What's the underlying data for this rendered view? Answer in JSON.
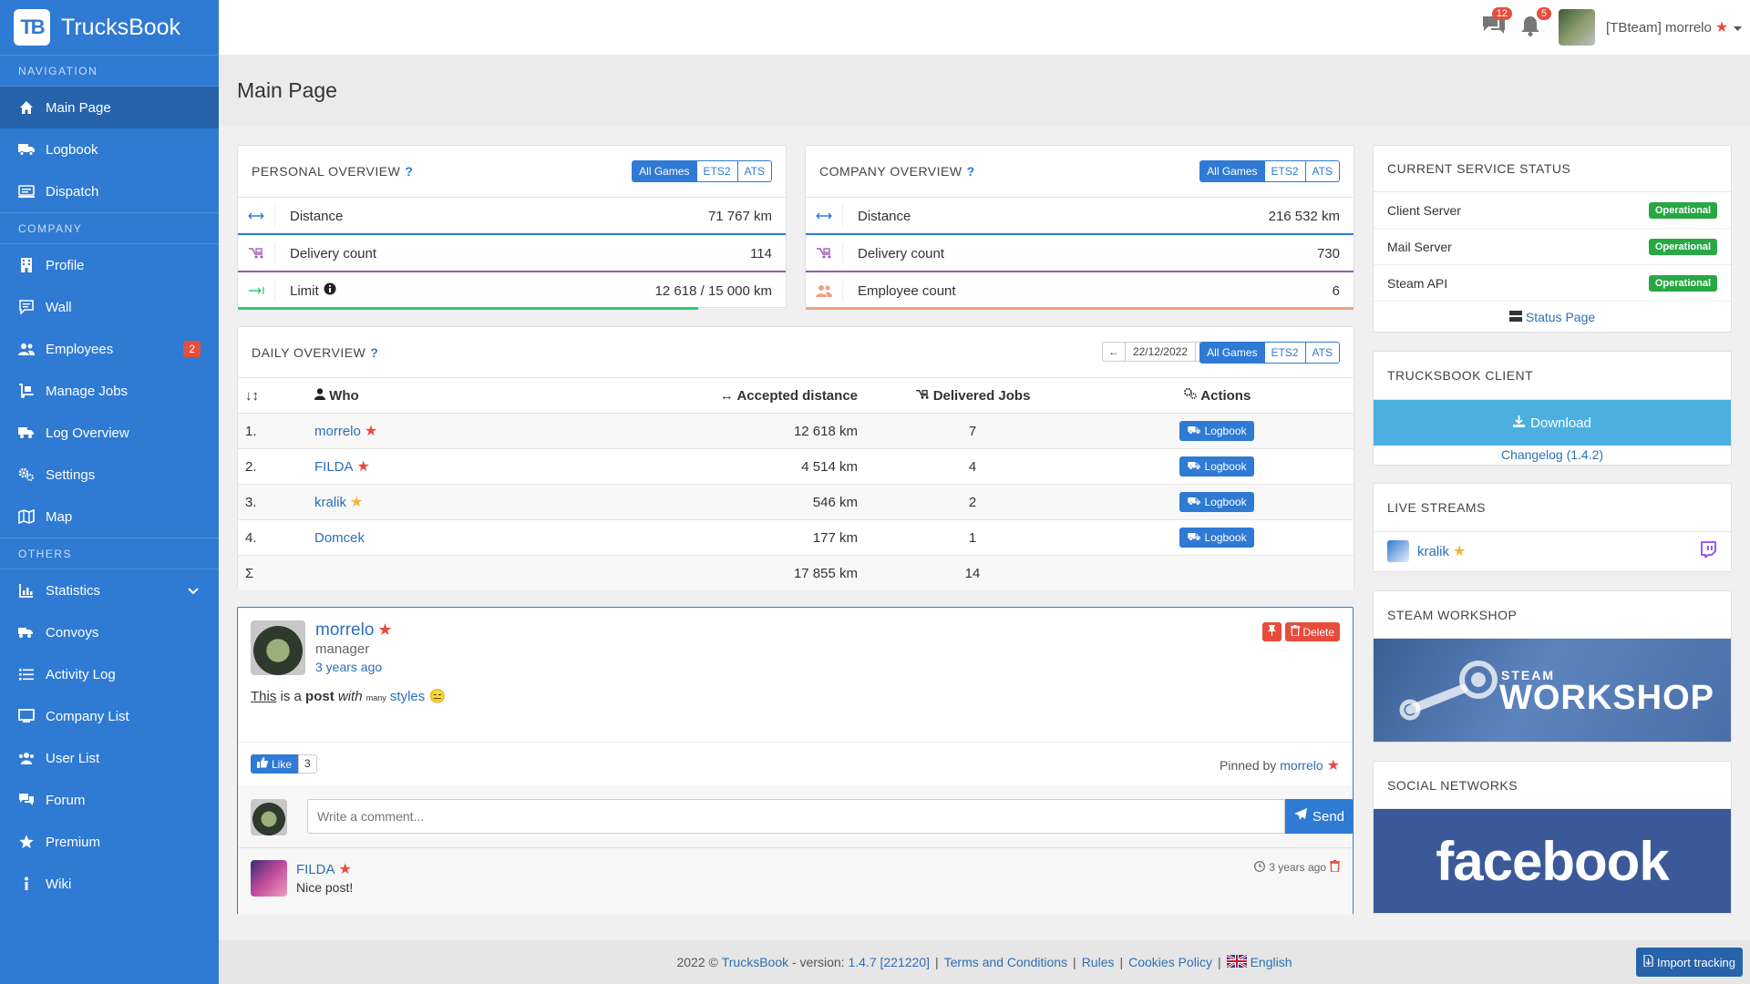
{
  "brand": {
    "logo": "TB",
    "name": "TrucksBook"
  },
  "sidebar": {
    "sections": [
      {
        "title": "NAVIGATION",
        "items": [
          {
            "label": "Main Page",
            "icon": "home-icon",
            "active": true
          },
          {
            "label": "Logbook",
            "icon": "truck-icon"
          },
          {
            "label": "Dispatch",
            "icon": "dispatch-icon"
          }
        ]
      },
      {
        "title": "COMPANY",
        "items": [
          {
            "label": "Profile",
            "icon": "building-icon"
          },
          {
            "label": "Wall",
            "icon": "comment-icon"
          },
          {
            "label": "Employees",
            "icon": "users-icon",
            "badge": "2"
          },
          {
            "label": "Manage Jobs",
            "icon": "dolly-icon"
          },
          {
            "label": "Log Overview",
            "icon": "truck-search-icon"
          },
          {
            "label": "Settings",
            "icon": "cogs-icon"
          },
          {
            "label": "Map",
            "icon": "map-icon"
          }
        ]
      },
      {
        "title": "OTHERS",
        "items": [
          {
            "label": "Statistics",
            "icon": "chart-icon",
            "chevron": true
          },
          {
            "label": "Convoys",
            "icon": "convoy-icon"
          },
          {
            "label": "Activity Log",
            "icon": "list-icon"
          },
          {
            "label": "Company List",
            "icon": "company-list-icon"
          },
          {
            "label": "User List",
            "icon": "user-list-icon"
          },
          {
            "label": "Forum",
            "icon": "forum-icon"
          },
          {
            "label": "Premium",
            "icon": "star-icon"
          },
          {
            "label": "Wiki",
            "icon": "info-icon"
          }
        ]
      }
    ]
  },
  "topbar": {
    "messages_count": "12",
    "notifications_count": "5",
    "user_name": "[TBteam] morrelo"
  },
  "page_title": "Main Page",
  "personal": {
    "title": "PERSONAL OVERVIEW",
    "q": "?",
    "filters": [
      "All Games",
      "ETS2",
      "ATS"
    ],
    "rows": [
      {
        "label": "Distance",
        "value": "71 767 km"
      },
      {
        "label": "Delivery count",
        "value": "114"
      },
      {
        "label": "Limit",
        "value": "12 618 / 15 000 km"
      }
    ],
    "limit_progress": 0.841
  },
  "company": {
    "title": "COMPANY OVERVIEW",
    "q": "?",
    "filters": [
      "All Games",
      "ETS2",
      "ATS"
    ],
    "rows": [
      {
        "label": "Distance",
        "value": "216 532 km"
      },
      {
        "label": "Delivery count",
        "value": "730"
      },
      {
        "label": "Employee count",
        "value": "6"
      }
    ]
  },
  "daily": {
    "title": "DAILY OVERVIEW",
    "q": "?",
    "date": "22/12/2022",
    "filters": [
      "All Games",
      "ETS2",
      "ATS"
    ],
    "headers": {
      "sort": "↓↕",
      "who": "Who",
      "distance": "Accepted distance",
      "jobs": "Delivered Jobs",
      "actions": "Actions"
    },
    "rows": [
      {
        "rank": "1.",
        "who": "morrelo",
        "star": "red",
        "distance": "12 618 km",
        "jobs": "7"
      },
      {
        "rank": "2.",
        "who": "FILDA",
        "star": "red",
        "distance": "4 514 km",
        "jobs": "4"
      },
      {
        "rank": "3.",
        "who": "kralik",
        "star": "gold",
        "distance": "546 km",
        "jobs": "2"
      },
      {
        "rank": "4.",
        "who": "Domcek",
        "star": "",
        "distance": "177 km",
        "jobs": "1"
      }
    ],
    "logbook_label": "Logbook",
    "total": {
      "sigma": "Σ",
      "distance": "17 855 km",
      "jobs": "14"
    }
  },
  "post": {
    "author": "morrelo",
    "role": "manager",
    "time": "3 years ago",
    "delete_label": "Delete",
    "text": {
      "this": "This",
      "is_a": " is a ",
      "post": "post",
      "with": "with",
      "many": "many",
      "styles": "styles"
    },
    "like_label": "Like",
    "like_count": "3",
    "pinned_by": "Pinned by",
    "pinned_user": "morrelo",
    "comment_placeholder": "Write a comment...",
    "send_label": "Send",
    "comments": [
      {
        "author": "FILDA",
        "text": "Nice post!",
        "time": "3 years ago"
      }
    ]
  },
  "service_status": {
    "title": "CURRENT SERVICE STATUS",
    "items": [
      {
        "label": "Client Server",
        "status": "Operational"
      },
      {
        "label": "Mail Server",
        "status": "Operational"
      },
      {
        "label": "Steam API",
        "status": "Operational"
      }
    ],
    "link": "Status Page"
  },
  "client": {
    "title": "TRUCKSBOOK CLIENT",
    "download": "Download",
    "changelog": "Changelog (1.4.2)"
  },
  "streams": {
    "title": "LIVE STREAMS",
    "user": "kralik"
  },
  "workshop": {
    "title": "STEAM WORKSHOP",
    "banner_small": "STEAM",
    "banner_big": "WORKSHOP"
  },
  "social": {
    "title": "SOCIAL NETWORKS",
    "banner": "facebook"
  },
  "footer": {
    "copyright": "2022 ©",
    "brand": "TrucksBook",
    "version_label": "- version:",
    "version": "1.4.7 [221220]",
    "terms": "Terms and Conditions",
    "rules": "Rules",
    "cookies": "Cookies Policy",
    "language": "English",
    "import": "Import tracking"
  },
  "colors": {
    "primary": "#2f7ad3",
    "sidebar_active": "#2763ab",
    "danger": "#e74c3c",
    "success": "#28a745",
    "purple": "#9b59b6",
    "green_bar": "#2ecc71",
    "orange": "#f0a080"
  }
}
